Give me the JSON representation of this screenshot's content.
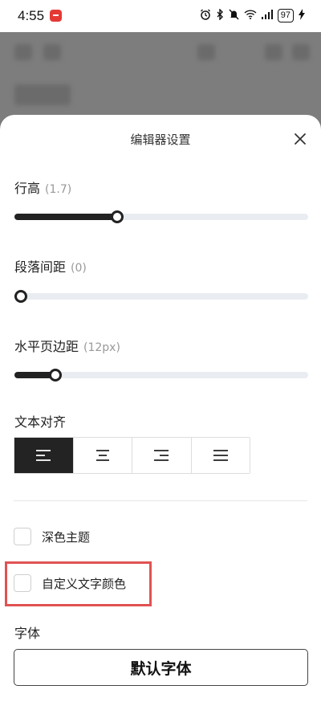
{
  "status_bar": {
    "time": "4:55",
    "battery": "97"
  },
  "sheet": {
    "title": "编辑器设置"
  },
  "settings": {
    "line_height": {
      "label": "行高",
      "value_text": "(1.7)",
      "fraction": 0.35
    },
    "paragraph_spacing": {
      "label": "段落间距",
      "value_text": "(0)",
      "fraction": 0.0
    },
    "horizontal_margin": {
      "label": "水平页边距",
      "value_text": "(12px)",
      "fraction": 0.14
    },
    "text_align": {
      "label": "文本对齐",
      "options": [
        "align-left",
        "align-center",
        "align-right",
        "align-justify"
      ],
      "selected": "align-left"
    },
    "dark_theme": {
      "label": "深色主题",
      "checked": false
    },
    "custom_text_color": {
      "label": "自定义文字颜色",
      "checked": false
    },
    "font": {
      "label": "字体",
      "button_label": "默认字体"
    }
  },
  "colors": {
    "accent": "#222222",
    "track": "#e9edf1",
    "highlight": "#e05252"
  }
}
